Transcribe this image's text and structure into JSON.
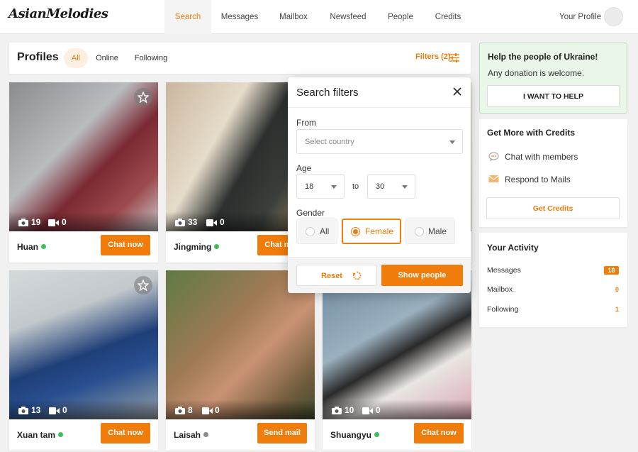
{
  "brand": {
    "logo": "AsianMelodies",
    "accent": "#f07c0b"
  },
  "nav": {
    "items": [
      "Search",
      "Messages",
      "Mailbox",
      "Newsfeed",
      "People",
      "Credits"
    ],
    "active": "Search",
    "profile": "Your Profile"
  },
  "profiles": {
    "title": "Profiles",
    "tabs": [
      "All",
      "Online",
      "Following"
    ],
    "active_tab": "All",
    "filters_label": "Filters (2)"
  },
  "cards": [
    {
      "name": "Huan",
      "photos": "19",
      "videos": "0",
      "online": true,
      "button": "Chat now",
      "starred_visible": true
    },
    {
      "name": "Jingming",
      "photos": "33",
      "videos": "0",
      "online": true,
      "button": "Chat now",
      "starred_visible": false
    },
    {
      "name": "Xuan tam",
      "photos": "13",
      "videos": "0",
      "online": true,
      "button": "Chat now",
      "starred_visible": true
    },
    {
      "name": "Laisah",
      "photos": "8",
      "videos": "0",
      "online": false,
      "button": "Send mail",
      "starred_visible": false
    },
    {
      "name": "Shuangyu",
      "photos": "10",
      "videos": "0",
      "online": true,
      "button": "Chat now",
      "starred_visible": false
    }
  ],
  "filters": {
    "title": "Search filters",
    "from_label": "From",
    "country_placeholder": "Select country",
    "age_label": "Age",
    "age_min": "18",
    "age_to": "to",
    "age_max": "30",
    "gender_label": "Gender",
    "gender_options": [
      "All",
      "Female",
      "Male"
    ],
    "gender_selected": "Female",
    "reset_label": "Reset",
    "show_label": "Show people"
  },
  "ukraine": {
    "title": "Help the people of Ukraine!",
    "subtitle": "Any donation is welcome.",
    "button": "I WANT TO HELP"
  },
  "credits_panel": {
    "title": "Get More with Credits",
    "items": [
      "Chat with members",
      "Respond to Mails"
    ],
    "button": "Get Credits"
  },
  "activity": {
    "title": "Your Activity",
    "rows": [
      {
        "label": "Messages",
        "value": "18"
      },
      {
        "label": "Mailbox",
        "value": "0"
      },
      {
        "label": "Following",
        "value": "1"
      }
    ]
  }
}
